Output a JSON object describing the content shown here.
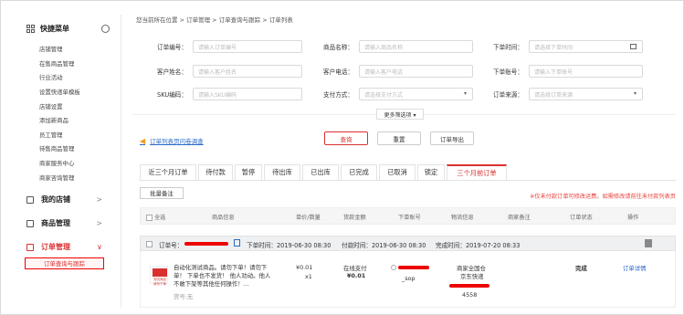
{
  "sidebar": {
    "title": "快捷菜单",
    "items": [
      "店铺管理",
      "在售商品管理",
      "行业活动",
      "设置快递单模板",
      "店铺设置",
      "添加新商品",
      "员工管理",
      "待售商品管理",
      "商家服务中心",
      "商家咨询管理"
    ],
    "groups": [
      {
        "label": "我的店铺",
        "chev": ">"
      },
      {
        "label": "商品管理",
        "chev": ">"
      },
      {
        "label": "订单管理",
        "chev": "∨"
      }
    ],
    "active_sub": "订单查询与跟踪"
  },
  "breadcrumb": "您当前所在位置 > 订单管理 > 订单查询与跟踪 > 订单列表",
  "filters": {
    "order_no": {
      "label": "订单编号：",
      "placeholder": "请输入订单编号"
    },
    "product_name": {
      "label": "商品名称：",
      "placeholder": "请输入商品名称"
    },
    "order_time": {
      "label": "下单时间：",
      "placeholder": "请选择下单时间"
    },
    "customer_name": {
      "label": "客户姓名：",
      "placeholder": "请输入客户姓名"
    },
    "customer_phone": {
      "label": "客户电话：",
      "placeholder": "请输入客户电话"
    },
    "order_account": {
      "label": "下单账号：",
      "placeholder": "请输入下单账号"
    },
    "sku_no": {
      "label": "SKU编码：",
      "placeholder": "请输入SKU编码"
    },
    "pay_method": {
      "label": "支付方式：",
      "placeholder": "请选择支付方式"
    },
    "order_source": {
      "label": "订单来源：",
      "placeholder": "请选择订单来源"
    },
    "more_label": "更多筛选项 ▾"
  },
  "actions": {
    "survey": "订单列表页问卷调查",
    "query": "查询",
    "reset": "重置",
    "export": "订单导出"
  },
  "tabs": [
    "近三个月订单",
    "待付款",
    "暂停",
    "待出库",
    "已出库",
    "已完成",
    "已取消",
    "锁定",
    "三个月前订单"
  ],
  "batch_label": "批量备注",
  "notice": "※仅未付款订单可修改运费。如需修改请前往未付款列表页",
  "table_headers": {
    "select_all": "全选",
    "product": "商品信息",
    "price_qty": "单价/数量",
    "amount": "货款金额",
    "account": "下单账号",
    "logistics": "物流信息",
    "merchant_note": "商家备注",
    "status": "订单状态",
    "ops": "操作"
  },
  "order": {
    "no_label": "订单号：",
    "order_time": "下单时间：2019-06-30 08:30",
    "pay_time": "付款时间：2019-06-30 08:30",
    "finish_time": "完成时间：2019-07-20 08:33",
    "product_desc": "自动化测试商品。请勿下单！请勿下单！ 下单也不发货！ 他人劝动。他人不敢下架等其他任何操作！...",
    "product_spec": "货号:无",
    "thumb_text": "测试商品 请勿下单",
    "unit_price": "¥0.01",
    "qty": "x1",
    "pay_type": "在线支付",
    "amount": "¥0.01",
    "account_suffix": "_sop",
    "logistics_1": "商家全国仓",
    "logistics_2": "京东快递",
    "logistics_3": "4558",
    "status": "完成",
    "detail_link": "订单详情"
  }
}
